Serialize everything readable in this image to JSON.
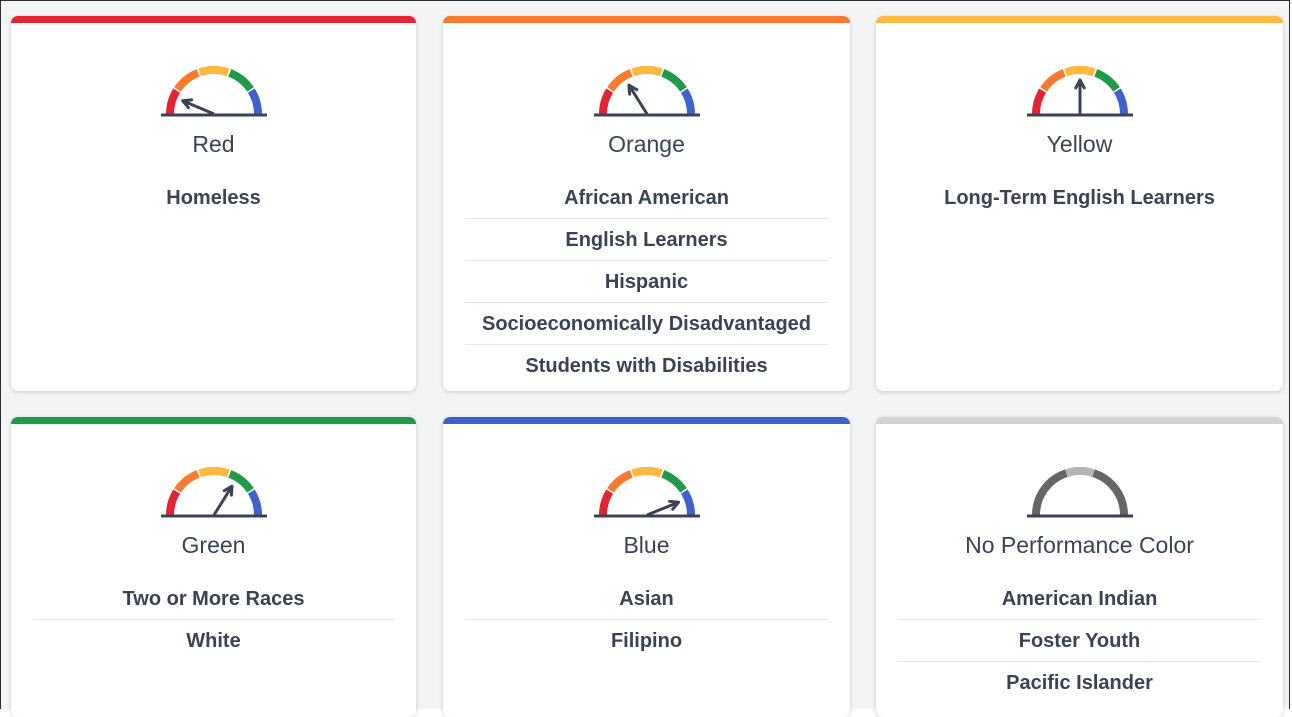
{
  "cards": [
    {
      "id": "red",
      "label": "Red",
      "bar_color": "#e02533",
      "needle": "red",
      "groups": [
        "Homeless"
      ]
    },
    {
      "id": "orange",
      "label": "Orange",
      "bar_color": "#f77a2f",
      "needle": "orange",
      "groups": [
        "African American",
        "English Learners",
        "Hispanic",
        "Socioeconomically Disadvantaged",
        "Students with Disabilities"
      ]
    },
    {
      "id": "yellow",
      "label": "Yellow",
      "bar_color": "#fdb841",
      "needle": "yellow",
      "groups": [
        "Long-Term English Learners"
      ]
    },
    {
      "id": "green",
      "label": "Green",
      "bar_color": "#1f9a48",
      "needle": "green",
      "groups": [
        "Two or More Races",
        "White"
      ]
    },
    {
      "id": "blue",
      "label": "Blue",
      "bar_color": "#3e62c9",
      "needle": "blue",
      "groups": [
        "Asian",
        "Filipino"
      ]
    },
    {
      "id": "none",
      "label": "No Performance Color",
      "bar_color": "#d3d3d3",
      "needle": "none",
      "groups": [
        "American Indian",
        "Foster Youth",
        "Pacific Islander"
      ]
    }
  ],
  "gauge_colors": {
    "red": "#e02533",
    "orange": "#f77a2f",
    "yellow": "#fdb841",
    "green": "#1f9a48",
    "blue": "#3e62c9",
    "gray_dark": "#666666",
    "gray_light": "#b5b5b5"
  }
}
